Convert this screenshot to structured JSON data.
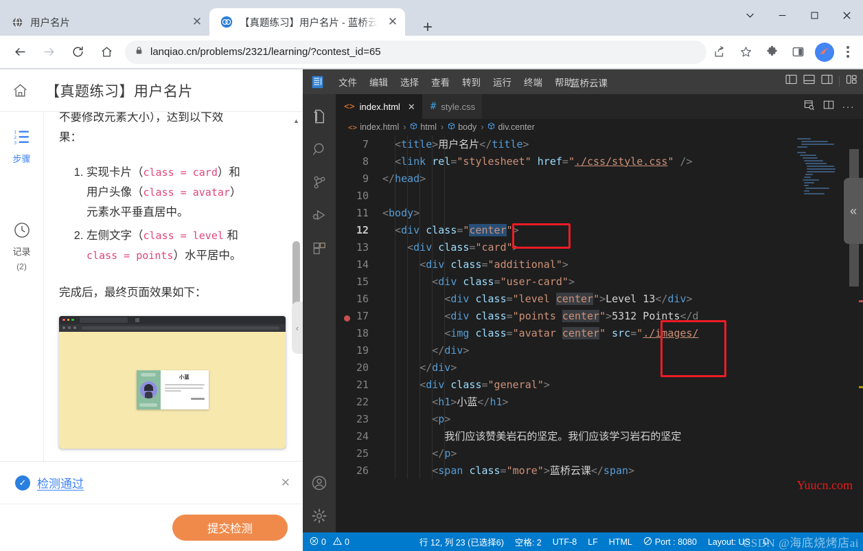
{
  "browser": {
    "tabs": [
      {
        "title": "用户名片",
        "favicon": "globe-icon",
        "active": false
      },
      {
        "title": "【真题练习】用户名片 - 蓝桥云课",
        "favicon": "lanqiao-icon",
        "active": true
      }
    ],
    "new_tab_label": "+",
    "window_controls": {
      "minimize": "—",
      "maximize": "□",
      "close": "✕",
      "chevron": "⌄"
    },
    "url": "lanqiao.cn/problems/2321/learning/?contest_id=65",
    "url_path_dim": "lanqiao.cn",
    "nav": {
      "back": "←",
      "forward": "→",
      "reload": "⟳",
      "home": "⌂"
    },
    "toolbar_icons": [
      "share-icon",
      "bookmark-star-icon",
      "extensions-icon",
      "side-panel-icon",
      "profile-avatar",
      "more-menu-icon"
    ]
  },
  "lanqiao": {
    "home_icon": "home-icon",
    "page_title": "【真题练习】用户名片",
    "rail": [
      {
        "icon": "steps-list-icon",
        "label": "步骤",
        "active": true
      },
      {
        "icon": "clock-icon",
        "label": "记录",
        "sub": "(2)",
        "active": false
      }
    ],
    "rail_bottom": [
      {
        "icon": "help-circle-icon",
        "label": ""
      },
      {
        "icon": "branch-icon",
        "label": ""
      }
    ],
    "content": {
      "clipped_line": "不要修改元素大小），达到以下效",
      "clipped_line2": "果：",
      "items": [
        {
          "prefix": "实现卡片（",
          "code1": "class = card",
          "mid": "）和",
          "line2_prefix": "用户头像（",
          "code2": "class = avatar",
          "line2_suffix": "）",
          "line3": "元素水平垂直居中。"
        },
        {
          "prefix": "左侧文字（",
          "code1": "class = level",
          "mid": " 和",
          "line2_code": "class = points",
          "line2_suffix": "）水平居中。"
        }
      ],
      "after_text": "完成后，最终页面效果如下："
    },
    "preview": {
      "card_name": "小蓝",
      "bg_color": "#f7e9ae",
      "card_side_color": "#8bbda0"
    },
    "result": {
      "icon": "check-circle-icon",
      "text": "检测通过",
      "close": "✕"
    },
    "submit_label": "提交检测",
    "submit_color": "#f08a4b"
  },
  "vscode": {
    "logo": "vscode-lanqiao-logo",
    "menu": [
      "文件",
      "编辑",
      "选择",
      "查看",
      "转到",
      "运行",
      "终端",
      "帮助"
    ],
    "brand": "蓝桥云课",
    "layout_icons": [
      "panel-left-icon",
      "panel-bottom-icon",
      "panel-right-icon",
      "customize-layout-icon"
    ],
    "activity_icons": [
      "explorer-icon",
      "search-icon",
      "source-control-icon",
      "run-debug-icon",
      "extensions-icon",
      "account-icon",
      "settings-gear-icon"
    ],
    "tabs": [
      {
        "label": "index.html",
        "icon": "html-file-icon",
        "active": true,
        "close": "✕"
      },
      {
        "label": "style.css",
        "icon": "css-file-icon",
        "active": false,
        "close": ""
      }
    ],
    "tab_actions": [
      "split-editor-search-icon",
      "split-editor-icon",
      "more-actions-icon"
    ],
    "breadcrumb": [
      "index.html",
      "html",
      "body",
      "div.center"
    ],
    "code_lines": [
      {
        "num": "7",
        "indent": 1,
        "segments": [
          {
            "t": "punc",
            "v": "<"
          },
          {
            "t": "tag",
            "v": "title"
          },
          {
            "t": "punc",
            "v": ">"
          },
          {
            "t": "txt",
            "v": "用户名片"
          },
          {
            "t": "punc",
            "v": "</"
          },
          {
            "t": "tag",
            "v": "title"
          },
          {
            "t": "punc",
            "v": ">"
          }
        ]
      },
      {
        "num": "8",
        "indent": 1,
        "segments": [
          {
            "t": "punc",
            "v": "<"
          },
          {
            "t": "tag",
            "v": "link"
          },
          {
            "t": "txt",
            "v": " "
          },
          {
            "t": "attr",
            "v": "rel"
          },
          {
            "t": "punc",
            "v": "="
          },
          {
            "t": "str",
            "v": "\"stylesheet\""
          },
          {
            "t": "txt",
            "v": " "
          },
          {
            "t": "attr",
            "v": "href"
          },
          {
            "t": "punc",
            "v": "="
          },
          {
            "t": "str",
            "v": "\""
          },
          {
            "t": "link",
            "v": "./css/style.css"
          },
          {
            "t": "str",
            "v": "\""
          },
          {
            "t": "txt",
            "v": " "
          },
          {
            "t": "punc",
            "v": "/>"
          }
        ]
      },
      {
        "num": "9",
        "indent": 0,
        "segments": [
          {
            "t": "punc",
            "v": "</"
          },
          {
            "t": "tag",
            "v": "head"
          },
          {
            "t": "punc",
            "v": ">"
          }
        ]
      },
      {
        "num": "10",
        "indent": 0,
        "segments": []
      },
      {
        "num": "11",
        "indent": 0,
        "segments": [
          {
            "t": "punc",
            "v": "<"
          },
          {
            "t": "tag",
            "v": "body"
          },
          {
            "t": "punc",
            "v": ">"
          }
        ]
      },
      {
        "num": "12",
        "indent": 1,
        "current": true,
        "segments": [
          {
            "t": "punc",
            "v": "<"
          },
          {
            "t": "tag",
            "v": "div"
          },
          {
            "t": "txt",
            "v": " "
          },
          {
            "t": "attr",
            "v": "class"
          },
          {
            "t": "punc",
            "v": "="
          },
          {
            "t": "str",
            "v": "\""
          },
          {
            "t": "str",
            "v": "center",
            "sel": true
          },
          {
            "t": "str",
            "v": "\""
          },
          {
            "t": "punc",
            "v": ">"
          }
        ]
      },
      {
        "num": "13",
        "indent": 2,
        "segments": [
          {
            "t": "punc",
            "v": "<"
          },
          {
            "t": "tag",
            "v": "div"
          },
          {
            "t": "txt",
            "v": " "
          },
          {
            "t": "attr",
            "v": "class"
          },
          {
            "t": "punc",
            "v": "="
          },
          {
            "t": "str",
            "v": "\"card\""
          },
          {
            "t": "punc",
            "v": ">"
          }
        ]
      },
      {
        "num": "14",
        "indent": 3,
        "segments": [
          {
            "t": "punc",
            "v": "<"
          },
          {
            "t": "tag",
            "v": "div"
          },
          {
            "t": "txt",
            "v": " "
          },
          {
            "t": "attr",
            "v": "class"
          },
          {
            "t": "punc",
            "v": "="
          },
          {
            "t": "str",
            "v": "\"additional\""
          },
          {
            "t": "punc",
            "v": ">"
          }
        ]
      },
      {
        "num": "15",
        "indent": 4,
        "segments": [
          {
            "t": "punc",
            "v": "<"
          },
          {
            "t": "tag",
            "v": "div"
          },
          {
            "t": "txt",
            "v": " "
          },
          {
            "t": "attr",
            "v": "class"
          },
          {
            "t": "punc",
            "v": "="
          },
          {
            "t": "str",
            "v": "\"user-card\""
          },
          {
            "t": "punc",
            "v": ">"
          }
        ]
      },
      {
        "num": "16",
        "indent": 5,
        "segments": [
          {
            "t": "punc",
            "v": "<"
          },
          {
            "t": "tag",
            "v": "div"
          },
          {
            "t": "txt",
            "v": " "
          },
          {
            "t": "attr",
            "v": "class"
          },
          {
            "t": "punc",
            "v": "="
          },
          {
            "t": "str",
            "v": "\"level "
          },
          {
            "t": "str",
            "v": "center",
            "hl": true
          },
          {
            "t": "str",
            "v": "\""
          },
          {
            "t": "punc",
            "v": ">"
          },
          {
            "t": "txt",
            "v": "Level 13"
          },
          {
            "t": "punc",
            "v": "</"
          },
          {
            "t": "tag",
            "v": "div"
          },
          {
            "t": "punc",
            "v": ">"
          }
        ]
      },
      {
        "num": "17",
        "indent": 5,
        "breakpoint": true,
        "segments": [
          {
            "t": "punc",
            "v": "<"
          },
          {
            "t": "tag",
            "v": "div"
          },
          {
            "t": "txt",
            "v": " "
          },
          {
            "t": "attr",
            "v": "class"
          },
          {
            "t": "punc",
            "v": "="
          },
          {
            "t": "str",
            "v": "\"points "
          },
          {
            "t": "str",
            "v": "center",
            "hl": true
          },
          {
            "t": "str",
            "v": "\""
          },
          {
            "t": "punc",
            "v": ">"
          },
          {
            "t": "txt",
            "v": "5312 Points"
          },
          {
            "t": "punc",
            "v": "</d"
          }
        ]
      },
      {
        "num": "18",
        "indent": 5,
        "segments": [
          {
            "t": "punc",
            "v": "<"
          },
          {
            "t": "tag",
            "v": "img"
          },
          {
            "t": "txt",
            "v": " "
          },
          {
            "t": "attr",
            "v": "class"
          },
          {
            "t": "punc",
            "v": "="
          },
          {
            "t": "str",
            "v": "\"avatar "
          },
          {
            "t": "str",
            "v": "center",
            "hl": true
          },
          {
            "t": "str",
            "v": "\""
          },
          {
            "t": "txt",
            "v": " "
          },
          {
            "t": "attr",
            "v": "src"
          },
          {
            "t": "punc",
            "v": "="
          },
          {
            "t": "str",
            "v": "\""
          },
          {
            "t": "link",
            "v": "./images/"
          }
        ]
      },
      {
        "num": "19",
        "indent": 4,
        "segments": [
          {
            "t": "punc",
            "v": "</"
          },
          {
            "t": "tag",
            "v": "div"
          },
          {
            "t": "punc",
            "v": ">"
          }
        ]
      },
      {
        "num": "20",
        "indent": 3,
        "segments": [
          {
            "t": "punc",
            "v": "</"
          },
          {
            "t": "tag",
            "v": "div"
          },
          {
            "t": "punc",
            "v": ">"
          }
        ]
      },
      {
        "num": "21",
        "indent": 3,
        "segments": [
          {
            "t": "punc",
            "v": "<"
          },
          {
            "t": "tag",
            "v": "div"
          },
          {
            "t": "txt",
            "v": " "
          },
          {
            "t": "attr",
            "v": "class"
          },
          {
            "t": "punc",
            "v": "="
          },
          {
            "t": "str",
            "v": "\"general\""
          },
          {
            "t": "punc",
            "v": ">"
          }
        ]
      },
      {
        "num": "22",
        "indent": 4,
        "segments": [
          {
            "t": "punc",
            "v": "<"
          },
          {
            "t": "tag",
            "v": "h1"
          },
          {
            "t": "punc",
            "v": ">"
          },
          {
            "t": "txt",
            "v": "小蓝"
          },
          {
            "t": "punc",
            "v": "</"
          },
          {
            "t": "tag",
            "v": "h1"
          },
          {
            "t": "punc",
            "v": ">"
          }
        ]
      },
      {
        "num": "23",
        "indent": 4,
        "segments": [
          {
            "t": "punc",
            "v": "<"
          },
          {
            "t": "tag",
            "v": "p"
          },
          {
            "t": "punc",
            "v": ">"
          }
        ]
      },
      {
        "num": "24",
        "indent": 5,
        "segments": [
          {
            "t": "txt",
            "v": "我们应该赞美岩石的坚定。我们应该学习岩石的坚定"
          }
        ]
      },
      {
        "num": "25",
        "indent": 4,
        "segments": [
          {
            "t": "punc",
            "v": "</"
          },
          {
            "t": "tag",
            "v": "p"
          },
          {
            "t": "punc",
            "v": ">"
          }
        ]
      },
      {
        "num": "26",
        "indent": 4,
        "segments": [
          {
            "t": "punc",
            "v": "<"
          },
          {
            "t": "tag",
            "v": "span"
          },
          {
            "t": "txt",
            "v": " "
          },
          {
            "t": "attr",
            "v": "class"
          },
          {
            "t": "punc",
            "v": "="
          },
          {
            "t": "str",
            "v": "\"more\""
          },
          {
            "t": "punc",
            "v": ">"
          },
          {
            "t": "txt",
            "v": "蓝桥云课"
          },
          {
            "t": "punc",
            "v": "</"
          },
          {
            "t": "tag",
            "v": "span"
          },
          {
            "t": "punc",
            "v": ">"
          }
        ]
      }
    ],
    "collapse_icon": "«",
    "status": {
      "errors": "0",
      "warnings": "0",
      "cursor": "行 12, 列 23 (已选择6)",
      "indent": "空格: 2",
      "encoding": "UTF-8",
      "eol": "LF",
      "language": "HTML",
      "port": "Port : 8080",
      "layout": "Layout: US",
      "bell": "bell-icon"
    }
  },
  "watermarks": {
    "yuucn": "Yuucn.com",
    "csdn": "CSDN @海底烧烤店ai"
  }
}
